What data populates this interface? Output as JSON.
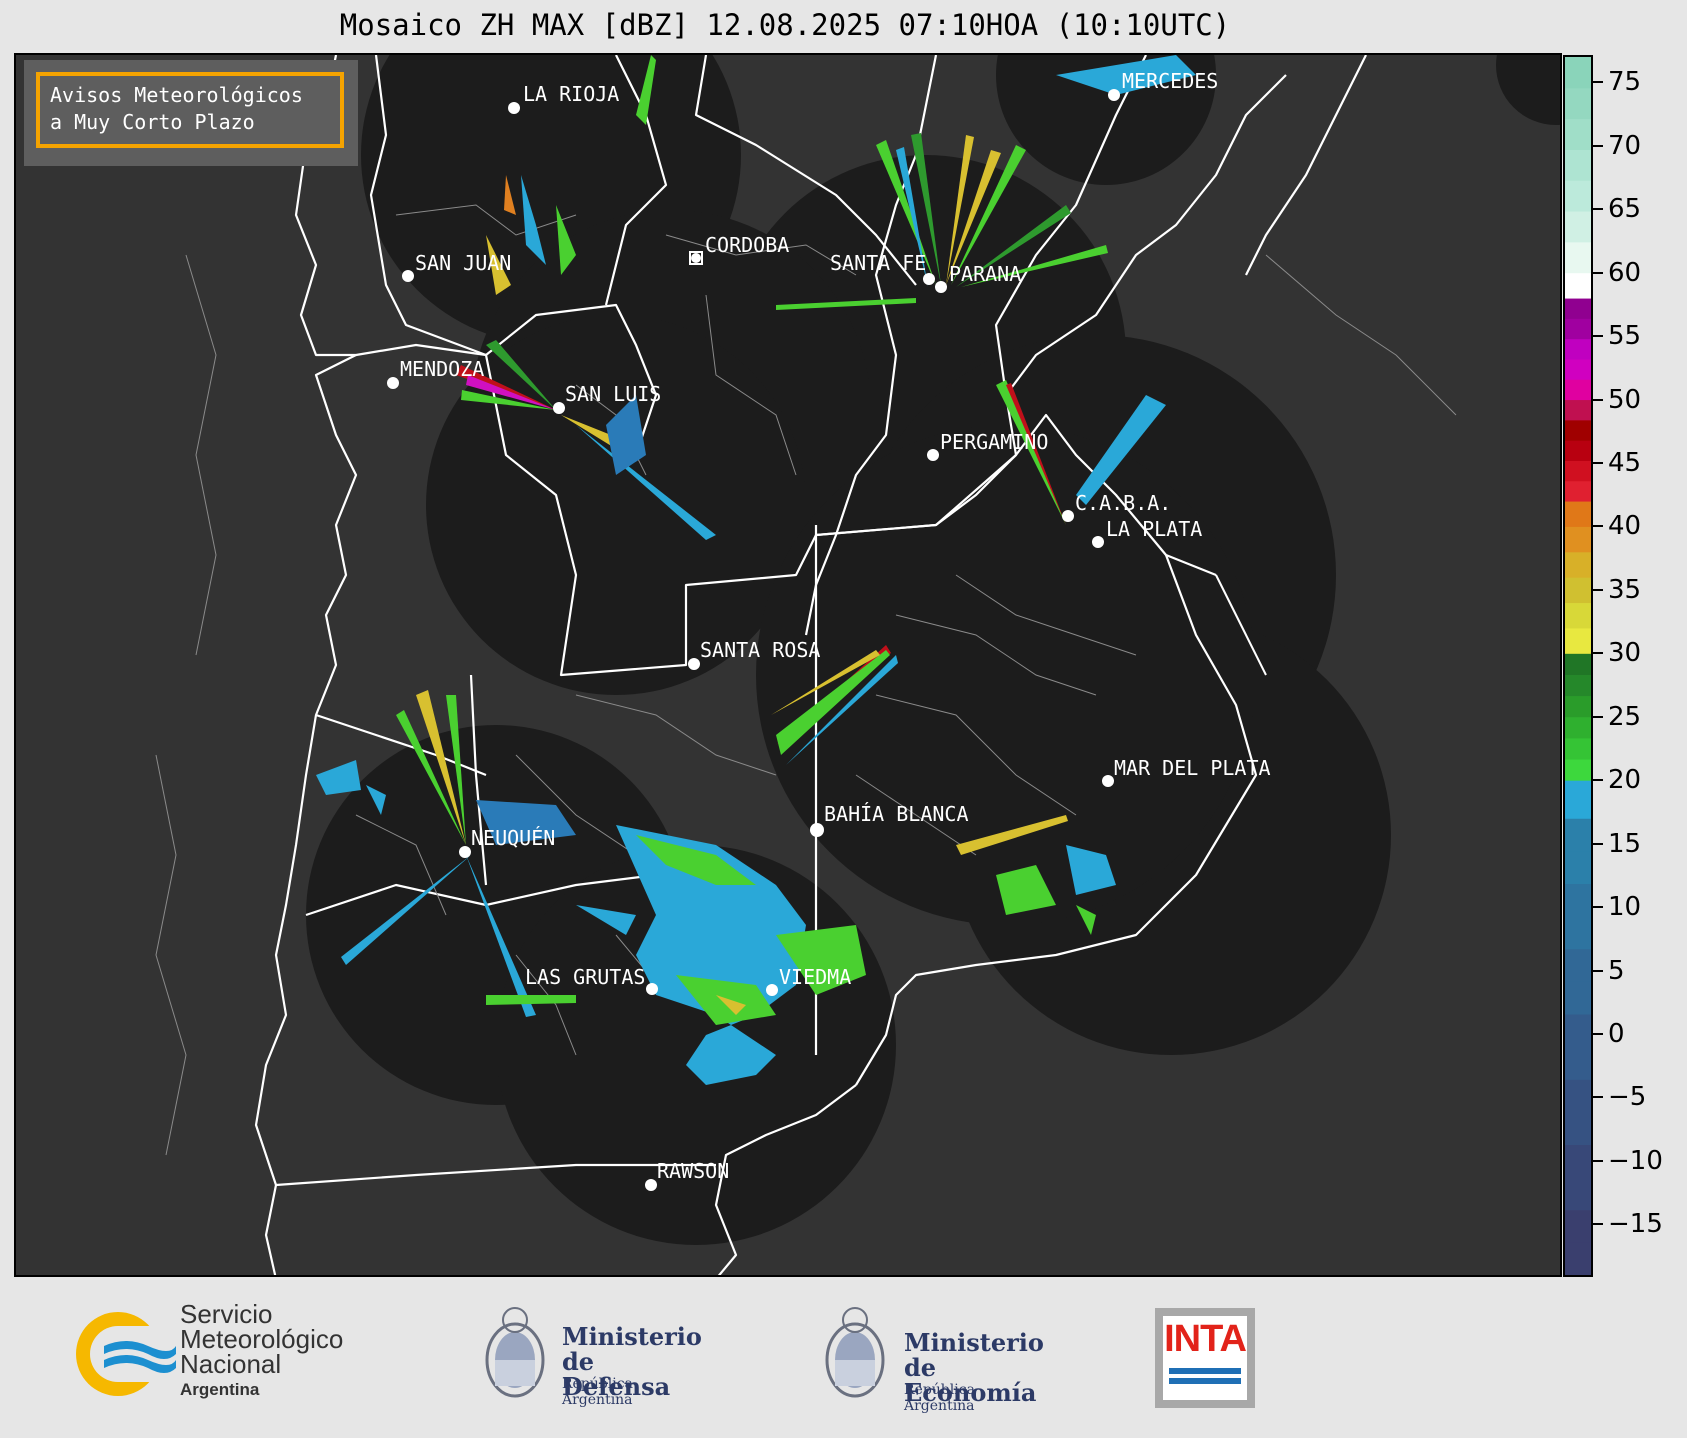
{
  "title": "Mosaico ZH MAX [dBZ] 12.08.2025 07:10HOA (10:10UTC)",
  "notice": {
    "line1": "Avisos Meteorológicos",
    "line2": "a Muy Corto Plazo"
  },
  "cities": [
    {
      "name": "LA RIOJA"
    },
    {
      "name": "MERCEDES"
    },
    {
      "name": "CORDOBA"
    },
    {
      "name": "SAN JUAN"
    },
    {
      "name": "SANTA FE"
    },
    {
      "name": "PARANA"
    },
    {
      "name": "MENDOZA"
    },
    {
      "name": "SAN LUIS"
    },
    {
      "name": "PERGAMINO"
    },
    {
      "name": "C.A.B.A."
    },
    {
      "name": "LA PLATA"
    },
    {
      "name": "SANTA ROSA"
    },
    {
      "name": "MAR DEL PLATA"
    },
    {
      "name": "BAHÍA BLANCA"
    },
    {
      "name": "NEUQUÉN"
    },
    {
      "name": "LAS GRUTAS"
    },
    {
      "name": "VIEDMA"
    },
    {
      "name": "RAWSON"
    }
  ],
  "colorbar": {
    "min": -19,
    "max": 77,
    "ticks": [
      "75",
      "70",
      "65",
      "60",
      "55",
      "50",
      "45",
      "40",
      "35",
      "30",
      "25",
      "20",
      "15",
      "10",
      "5",
      "0",
      "−5",
      "−10",
      "−15"
    ],
    "tick_values": [
      75,
      70,
      65,
      60,
      55,
      50,
      45,
      40,
      35,
      30,
      25,
      20,
      15,
      10,
      5,
      0,
      -5,
      -10,
      -15
    ],
    "colors": {
      "below_0": "#3a4a7d",
      "0_to_17": "#2a7bb8",
      "17_to_20": "#2aa8d8",
      "20_to_30": "#2e9a2e",
      "30_to_40": "#d8c030",
      "40_to_45": "#e08020",
      "45_to_50": "#c0101a",
      "50_to_58": "#d010c0",
      "58_to_60": "#ffffff",
      "60_to_77": "#9ee0c6"
    }
  },
  "logos": {
    "smn": {
      "line1": "Servicio",
      "line2": "Meteorológico",
      "line3": "Nacional",
      "line4": "Argentina"
    },
    "defensa": {
      "line1": "Ministerio",
      "line2": "de Defensa",
      "line3": "República Argentina"
    },
    "economia": {
      "line1": "Ministerio",
      "line2": "de Economía",
      "line3": "República Argentina"
    },
    "inta": {
      "text": "INTA"
    }
  }
}
